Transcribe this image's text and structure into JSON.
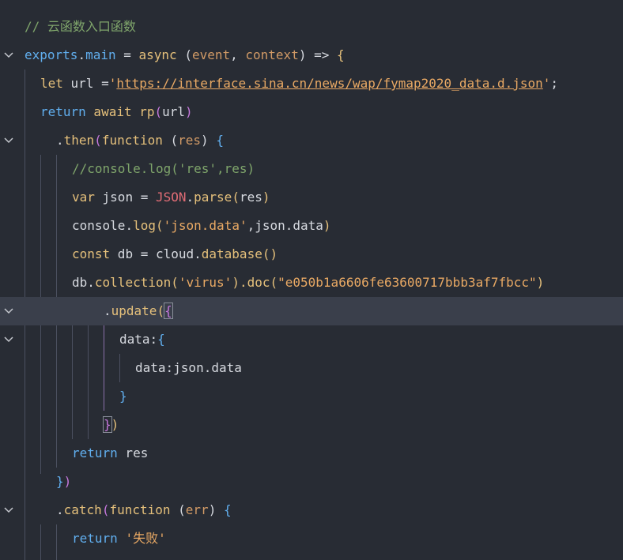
{
  "editor": {
    "lines": [
      {
        "indent": 0,
        "fold": false,
        "active": false,
        "tokens": [
          {
            "t": "// 云函数入口函数",
            "c": "com"
          }
        ]
      },
      {
        "indent": 0,
        "fold": true,
        "active": false,
        "tokens": [
          {
            "t": "exports",
            "c": "var"
          },
          {
            "t": ".",
            "c": "op"
          },
          {
            "t": "main",
            "c": "var"
          },
          {
            "t": " = ",
            "c": "op"
          },
          {
            "t": "async",
            "c": "fn"
          },
          {
            "t": " (",
            "c": "op"
          },
          {
            "t": "event",
            "c": "par"
          },
          {
            "t": ", ",
            "c": "op"
          },
          {
            "t": "context",
            "c": "par"
          },
          {
            "t": ") => ",
            "c": "op"
          },
          {
            "t": "{",
            "c": "brk"
          }
        ]
      },
      {
        "indent": 1,
        "fold": false,
        "active": false,
        "tokens": [
          {
            "t": "let",
            "c": "fn"
          },
          {
            "t": " url =",
            "c": "txt"
          },
          {
            "t": "'",
            "c": "str"
          },
          {
            "t": "https://interface.sina.cn/news/wap/fymap2020_data.d.json",
            "c": "url"
          },
          {
            "t": "'",
            "c": "str"
          },
          {
            "t": ";",
            "c": "txt"
          }
        ]
      },
      {
        "indent": 1,
        "fold": false,
        "active": false,
        "tokens": [
          {
            "t": "return",
            "c": "var"
          },
          {
            "t": " await ",
            "c": "fn"
          },
          {
            "t": "rp",
            "c": "fn"
          },
          {
            "t": "(",
            "c": "brk2"
          },
          {
            "t": "url",
            "c": "txt"
          },
          {
            "t": ")",
            "c": "brk2"
          }
        ]
      },
      {
        "indent": 2,
        "fold": true,
        "active": false,
        "tokens": [
          {
            "t": ".",
            "c": "txt"
          },
          {
            "t": "then",
            "c": "fn"
          },
          {
            "t": "(",
            "c": "brk2"
          },
          {
            "t": "function",
            "c": "fn"
          },
          {
            "t": " (",
            "c": "txt"
          },
          {
            "t": "res",
            "c": "par"
          },
          {
            "t": ") ",
            "c": "txt"
          },
          {
            "t": "{",
            "c": "var"
          }
        ]
      },
      {
        "indent": 3,
        "fold": false,
        "active": false,
        "tokens": [
          {
            "t": "//console.log('res',res)",
            "c": "com"
          }
        ]
      },
      {
        "indent": 3,
        "fold": false,
        "active": false,
        "tokens": [
          {
            "t": "var",
            "c": "fn"
          },
          {
            "t": " json = ",
            "c": "txt"
          },
          {
            "t": "JSON",
            "c": "obj"
          },
          {
            "t": ".",
            "c": "txt"
          },
          {
            "t": "parse",
            "c": "fn"
          },
          {
            "t": "(",
            "c": "brk"
          },
          {
            "t": "res",
            "c": "txt"
          },
          {
            "t": ")",
            "c": "brk"
          }
        ]
      },
      {
        "indent": 3,
        "fold": false,
        "active": false,
        "tokens": [
          {
            "t": "console",
            "c": "txt"
          },
          {
            "t": ".",
            "c": "txt"
          },
          {
            "t": "log",
            "c": "fn"
          },
          {
            "t": "(",
            "c": "brk"
          },
          {
            "t": "'json.data'",
            "c": "str"
          },
          {
            "t": ",json.data",
            "c": "txt"
          },
          {
            "t": ")",
            "c": "brk"
          }
        ]
      },
      {
        "indent": 3,
        "fold": false,
        "active": false,
        "tokens": [
          {
            "t": "const",
            "c": "fn"
          },
          {
            "t": " db = cloud.",
            "c": "txt"
          },
          {
            "t": "database",
            "c": "fn"
          },
          {
            "t": "()",
            "c": "brk"
          }
        ]
      },
      {
        "indent": 3,
        "fold": false,
        "active": false,
        "tokens": [
          {
            "t": "db",
            "c": "txt"
          },
          {
            "t": ".",
            "c": "txt"
          },
          {
            "t": "collection",
            "c": "fn"
          },
          {
            "t": "(",
            "c": "brk"
          },
          {
            "t": "'virus'",
            "c": "str"
          },
          {
            "t": ").",
            "c": "brk"
          },
          {
            "t": "doc",
            "c": "fn"
          },
          {
            "t": "(",
            "c": "brk"
          },
          {
            "t": "\"e050b1a6606fe63600717bbb3af7fbcc\"",
            "c": "str"
          },
          {
            "t": ")",
            "c": "brk"
          }
        ]
      },
      {
        "indent": 5,
        "fold": true,
        "active": true,
        "tokens": [
          {
            "t": ".",
            "c": "txt"
          },
          {
            "t": "update",
            "c": "fn"
          },
          {
            "t": "(",
            "c": "brk"
          },
          {
            "t": "{",
            "c": "brk2",
            "cur": true
          }
        ]
      },
      {
        "indent": 6,
        "fold": true,
        "active": false,
        "tokens": [
          {
            "t": "data",
            "c": "txt"
          },
          {
            "t": ":",
            "c": "txt"
          },
          {
            "t": "{",
            "c": "var"
          }
        ]
      },
      {
        "indent": 7,
        "fold": false,
        "active": false,
        "tokens": [
          {
            "t": "data",
            "c": "txt"
          },
          {
            "t": ":json.data",
            "c": "txt"
          }
        ]
      },
      {
        "indent": 6,
        "fold": false,
        "active": false,
        "tokens": [
          {
            "t": "}",
            "c": "var"
          }
        ]
      },
      {
        "indent": 5,
        "fold": false,
        "active": false,
        "tokens": [
          {
            "t": "}",
            "c": "brk2",
            "cur": true
          },
          {
            "t": ")",
            "c": "brk"
          }
        ]
      },
      {
        "indent": 3,
        "fold": false,
        "active": false,
        "tokens": [
          {
            "t": "return",
            "c": "var"
          },
          {
            "t": " res",
            "c": "txt"
          }
        ]
      },
      {
        "indent": 2,
        "fold": false,
        "active": false,
        "tokens": [
          {
            "t": "}",
            "c": "var"
          },
          {
            "t": ")",
            "c": "brk2"
          }
        ]
      },
      {
        "indent": 2,
        "fold": true,
        "active": false,
        "tokens": [
          {
            "t": ".",
            "c": "txt"
          },
          {
            "t": "catch",
            "c": "fn"
          },
          {
            "t": "(",
            "c": "brk2"
          },
          {
            "t": "function",
            "c": "fn"
          },
          {
            "t": " (",
            "c": "txt"
          },
          {
            "t": "err",
            "c": "par"
          },
          {
            "t": ") ",
            "c": "txt"
          },
          {
            "t": "{",
            "c": "var"
          }
        ]
      },
      {
        "indent": 3,
        "fold": false,
        "active": false,
        "tokens": [
          {
            "t": "return",
            "c": "var"
          },
          {
            "t": " ",
            "c": "txt"
          },
          {
            "t": "'失败'",
            "c": "str"
          }
        ]
      }
    ]
  }
}
